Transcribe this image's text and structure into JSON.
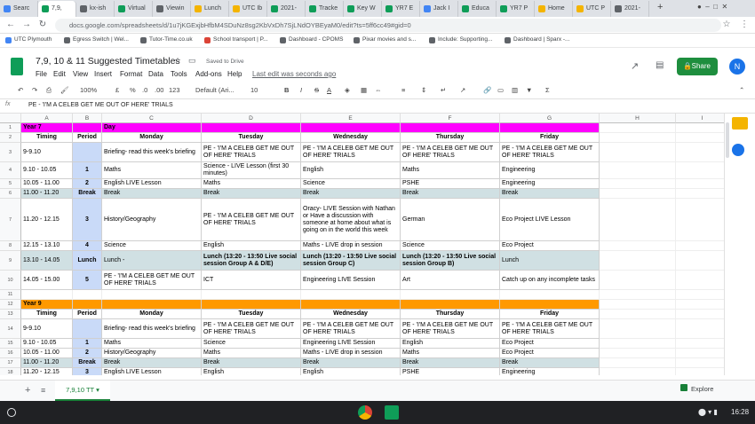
{
  "browser": {
    "tabs": [
      {
        "label": "Searc",
        "color": "#4285f4",
        "active": false
      },
      {
        "label": "7,9,",
        "color": "#0f9d58",
        "active": true
      },
      {
        "label": "kx-ish",
        "color": "#5f6368",
        "active": false
      },
      {
        "label": "Virtual",
        "color": "#0f9d58",
        "active": false
      },
      {
        "label": "Viewin",
        "color": "#5f6368",
        "active": false
      },
      {
        "label": "Lunch",
        "color": "#f4b400",
        "active": false
      },
      {
        "label": "UTC Ib",
        "color": "#f4b400",
        "active": false
      },
      {
        "label": "2021-",
        "color": "#0f9d58",
        "active": false
      },
      {
        "label": "Tracke",
        "color": "#0f9d58",
        "active": false
      },
      {
        "label": "Key W",
        "color": "#0f9d58",
        "active": false
      },
      {
        "label": "YR7 E",
        "color": "#0f9d58",
        "active": false
      },
      {
        "label": "Jack I",
        "color": "#4285f4",
        "active": false
      },
      {
        "label": "Educa",
        "color": "#0f9d58",
        "active": false
      },
      {
        "label": "YR7 P",
        "color": "#0f9d58",
        "active": false
      },
      {
        "label": "Home",
        "color": "#f4b400",
        "active": false
      },
      {
        "label": "UTC P",
        "color": "#f4b400",
        "active": false
      },
      {
        "label": "2021-",
        "color": "#5f6368",
        "active": false
      }
    ],
    "new_tab": "+",
    "url": "docs.google.com/spreadsheets/d/1u7jKGExjbHfbM4SDuNz8sg2KbVxDh7SjLNdOYBEyaM0/edit?ts=5ff6cc49#gid=0",
    "bookmarks": [
      {
        "label": "UTC Plymouth",
        "color": "#4285f4"
      },
      {
        "label": "Egress Switch | Wel...",
        "color": "#5f6368"
      },
      {
        "label": "Tutor-Time.co.uk",
        "color": "#5f6368"
      },
      {
        "label": "School transport | P...",
        "color": "#db4437"
      },
      {
        "label": "Dashboard - CPOMS",
        "color": "#5f6368"
      },
      {
        "label": "Pixar movies and s...",
        "color": "#5f6368"
      },
      {
        "label": "Include: Supporting...",
        "color": "#5f6368"
      },
      {
        "label": "Dashboard | Sparx -...",
        "color": "#5f6368"
      }
    ]
  },
  "doc": {
    "title": "7,9, 10 & 11 Suggested Timetables",
    "saved": "Saved to Drive",
    "menus": [
      "File",
      "Edit",
      "View",
      "Insert",
      "Format",
      "Data",
      "Tools",
      "Add-ons",
      "Help"
    ],
    "last_edit": "Last edit was seconds ago",
    "share": "Share",
    "avatar": "N"
  },
  "toolbar": {
    "zoom": "100%",
    "currency": "£",
    "percent": "%",
    "dec0": ".0",
    "dec00": ".00",
    "fmt": "123",
    "font": "Default (Ari...",
    "size": "10"
  },
  "formula": {
    "fx": "fx",
    "value": "PE - 'I'M A CELEB GET ME OUT OF HERE' TRIALS"
  },
  "columns": [
    "A",
    "B",
    "C",
    "D",
    "E",
    "F",
    "G",
    "H",
    "I"
  ],
  "rows": [
    {
      "n": "1",
      "h": 11,
      "cells": [
        "Year 7",
        "",
        "Day",
        "",
        "",
        "",
        "",
        ""
      ],
      "type": "hdr7"
    },
    {
      "n": "2",
      "h": 11,
      "cells": [
        "Timing",
        "Period",
        "Monday",
        "Tuesday",
        "Wednesday",
        "Thursday",
        "Friday",
        ""
      ],
      "type": "colnames"
    },
    {
      "n": "3",
      "h": 22,
      "cells": [
        "9-9.10",
        "",
        "Briefing- read this week's briefing",
        "PE - 'I'M A CELEB GET ME OUT OF HERE' TRIALS",
        "PE - 'I'M A CELEB GET ME OUT OF HERE' TRIALS",
        "PE - 'I'M A CELEB GET ME OUT OF HERE' TRIALS",
        "PE - 'I'M A CELEB GET ME OUT OF HERE' TRIALS",
        ""
      ]
    },
    {
      "n": "4",
      "h": 19,
      "cells": [
        "9.10 - 10.05",
        "1",
        "Maths",
        "Science - LIVE Lesson (first 30 minutes)",
        "English",
        "Maths",
        "Engineering",
        ""
      ]
    },
    {
      "n": "5",
      "h": 11,
      "cells": [
        "10.05 - 11.00",
        "2",
        "English LIVE Lesson",
        "Maths",
        "Science",
        "PSHE",
        "Engineering",
        ""
      ]
    },
    {
      "n": "6",
      "h": 11,
      "cells": [
        "11.00 - 11.20",
        "Break",
        "Break",
        "Break",
        "Break",
        "Break",
        "Break",
        ""
      ],
      "type": "break"
    },
    {
      "n": "7",
      "h": 48,
      "cells": [
        "11.20 - 12.15",
        "3",
        "History/Geography",
        "PE - 'I'M A CELEB GET ME OUT OF HERE' TRIALS",
        "Oracy- LIVE Session with Nathan or Have a discussion with someone at home about what is going on in the world this week",
        "German",
        "Eco Project LIVE Lesson",
        ""
      ]
    },
    {
      "n": "8",
      "h": 11,
      "cells": [
        "12.15 - 13.10",
        "4",
        "Science",
        "English",
        "Maths - LIVE drop in session",
        "Science",
        "Eco Project",
        ""
      ]
    },
    {
      "n": "9",
      "h": 22,
      "cells": [
        "13.10 - 14.05",
        "Lunch",
        "Lunch -",
        "Lunch (13:20 - 13:50 Live social session Group A & D/E)",
        "Lunch (13:20 - 13:50 Live social session Group C)",
        "Lunch (13:20 - 13:50 Live social session Group B)",
        "Lunch",
        ""
      ],
      "type": "lunch"
    },
    {
      "n": "10",
      "h": 22,
      "cells": [
        "14.05 - 15.00",
        "5",
        "PE - 'I'M A CELEB GET ME OUT OF HERE' TRIALS",
        "ICT",
        "Engineering LIVE Session",
        "Art",
        "Catch up on any incomplete tasks",
        ""
      ]
    },
    {
      "n": "11",
      "h": 11,
      "cells": [
        "",
        "",
        "",
        "",
        "",
        "",
        "",
        ""
      ],
      "type": "blank"
    },
    {
      "n": "12",
      "h": 11,
      "cells": [
        "Year 9",
        "",
        "",
        "",
        "",
        "",
        "",
        ""
      ],
      "type": "hdr9"
    },
    {
      "n": "13",
      "h": 11,
      "cells": [
        "Timing",
        "Period",
        "Monday",
        "Tuesday",
        "Wednesday",
        "Thursday",
        "Friday",
        ""
      ],
      "type": "colnames"
    },
    {
      "n": "14",
      "h": 22,
      "cells": [
        "9-9.10",
        "",
        "Briefing- read this week's briefing",
        "PE - 'I'M A CELEB GET ME OUT OF HERE' TRIALS",
        "PE - 'I'M A CELEB GET ME OUT OF HERE' TRIALS",
        "PE - 'I'M A CELEB GET ME OUT OF HERE' TRIALS",
        "PE - 'I'M A CELEB GET ME OUT OF HERE' TRIALS",
        ""
      ]
    },
    {
      "n": "15",
      "h": 11,
      "cells": [
        "9.10 - 10.05",
        "1",
        "Maths",
        "Science",
        "Engineering LIVE Session",
        "English",
        "Eco Project",
        ""
      ]
    },
    {
      "n": "16",
      "h": 11,
      "cells": [
        "10.05 - 11.00",
        "2",
        "History/Geography",
        "Maths",
        "Maths - LIVE drop in session",
        "Maths",
        "Eco Project",
        ""
      ]
    },
    {
      "n": "17",
      "h": 11,
      "cells": [
        "11.00 - 11.20",
        "Break",
        "Break",
        "Break",
        "Break",
        "Break",
        "Break",
        ""
      ],
      "type": "break"
    },
    {
      "n": "18",
      "h": 11,
      "cells": [
        "11.20 - 12.15",
        "3",
        "English LIVE Lesson",
        "English",
        "English",
        "PSHE",
        "Engineering",
        ""
      ]
    }
  ],
  "sheet_tabs": {
    "add": "+",
    "menu": "≡",
    "active": "7,9,10 TT",
    "explore": "Explore"
  },
  "taskbar": {
    "time": "16:28"
  }
}
